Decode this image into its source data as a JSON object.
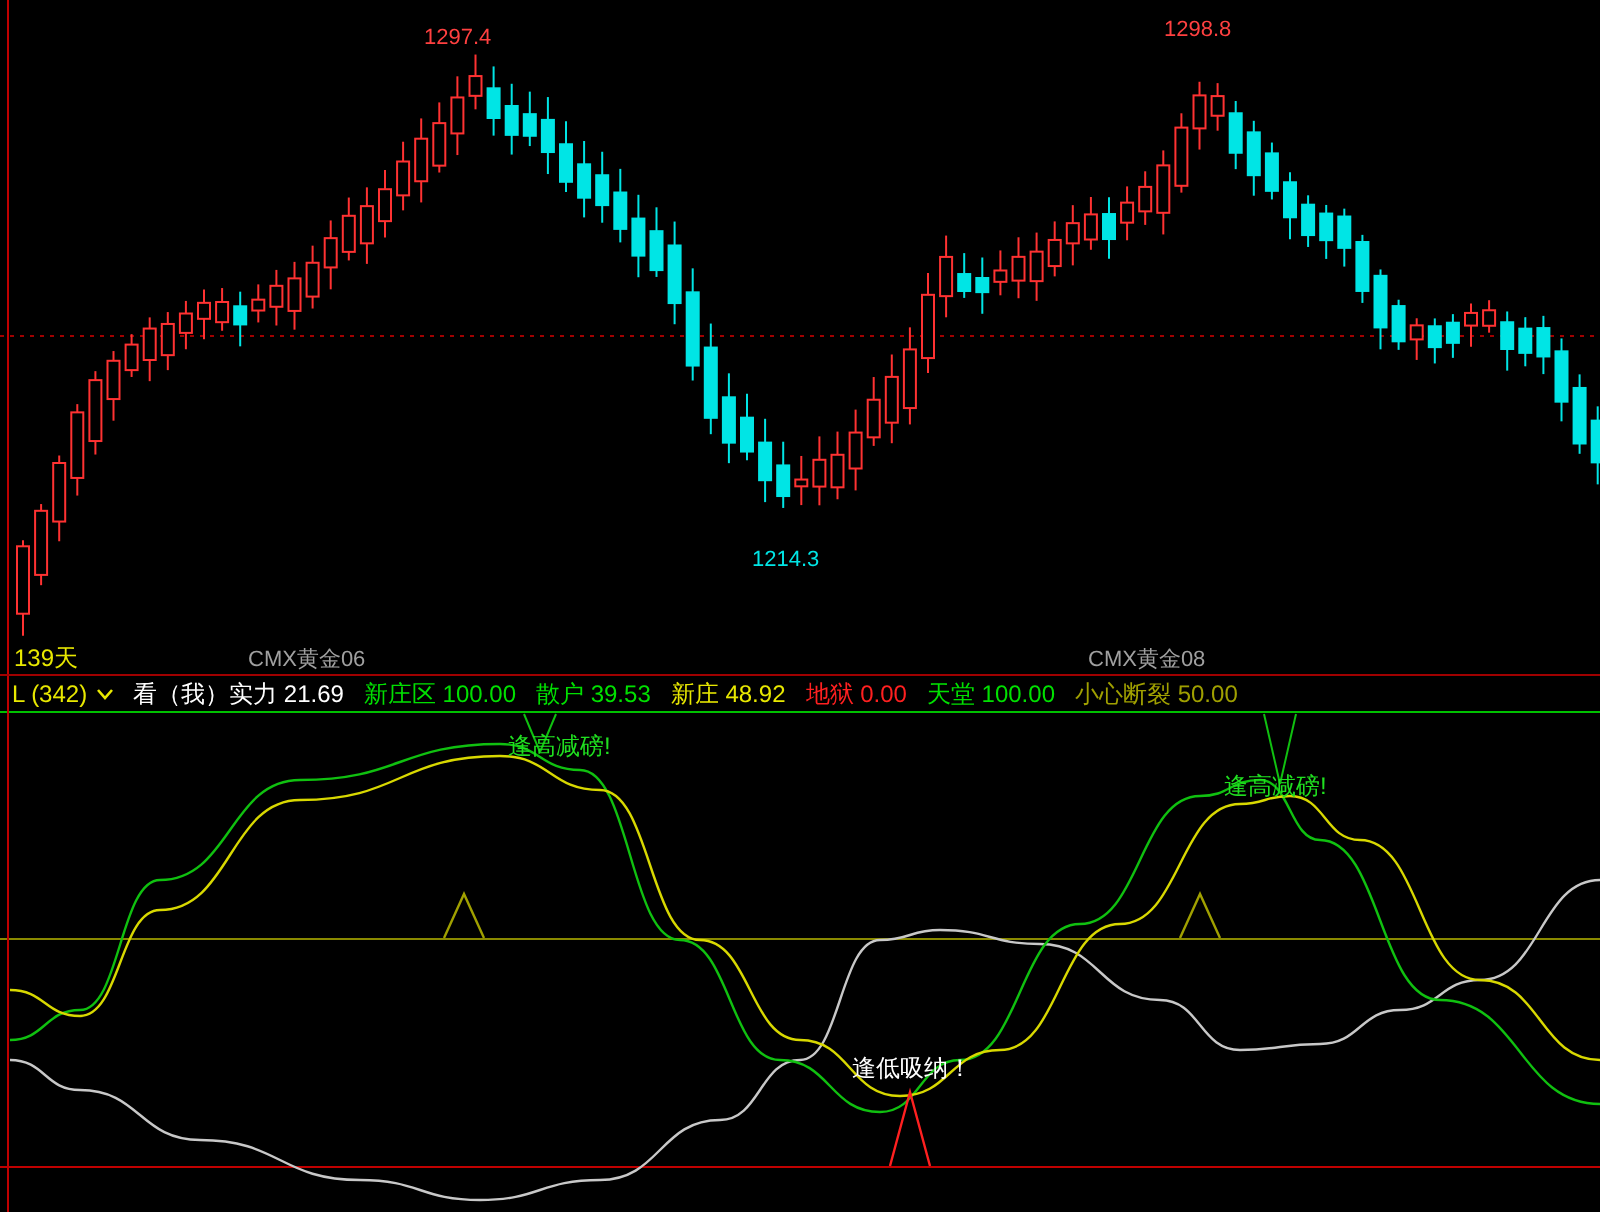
{
  "main_chart": {
    "price_labels": [
      {
        "text": "1297.4",
        "kind": "high"
      },
      {
        "text": "1298.8",
        "kind": "high"
      },
      {
        "text": "1214.3",
        "kind": "low"
      }
    ],
    "period_label": "139天",
    "contract_labels": [
      "CMX黄金06",
      "CMX黄金08"
    ]
  },
  "indicator": {
    "name": "L (342)",
    "legend": [
      {
        "label": "看（我）实力",
        "value": "21.69",
        "color": "#ffffff"
      },
      {
        "label": "新庄区",
        "value": "100.00",
        "color": "#00e000"
      },
      {
        "label": "散户",
        "value": "39.53",
        "color": "#00e000"
      },
      {
        "label": "新庄",
        "value": "48.92",
        "color": "#e8e800"
      },
      {
        "label": "地狱",
        "value": "0.00",
        "color": "#ff2020"
      },
      {
        "label": "天堂",
        "value": "100.00",
        "color": "#00e000"
      },
      {
        "label": "小心断裂",
        "value": "50.00",
        "color": "#a0a000"
      }
    ],
    "signals": [
      {
        "text": "逢高减磅!",
        "kind": "sell"
      },
      {
        "text": "逢低吸纳！",
        "kind": "buy"
      },
      {
        "text": "逢高减磅!",
        "kind": "sell"
      }
    ]
  }
}
